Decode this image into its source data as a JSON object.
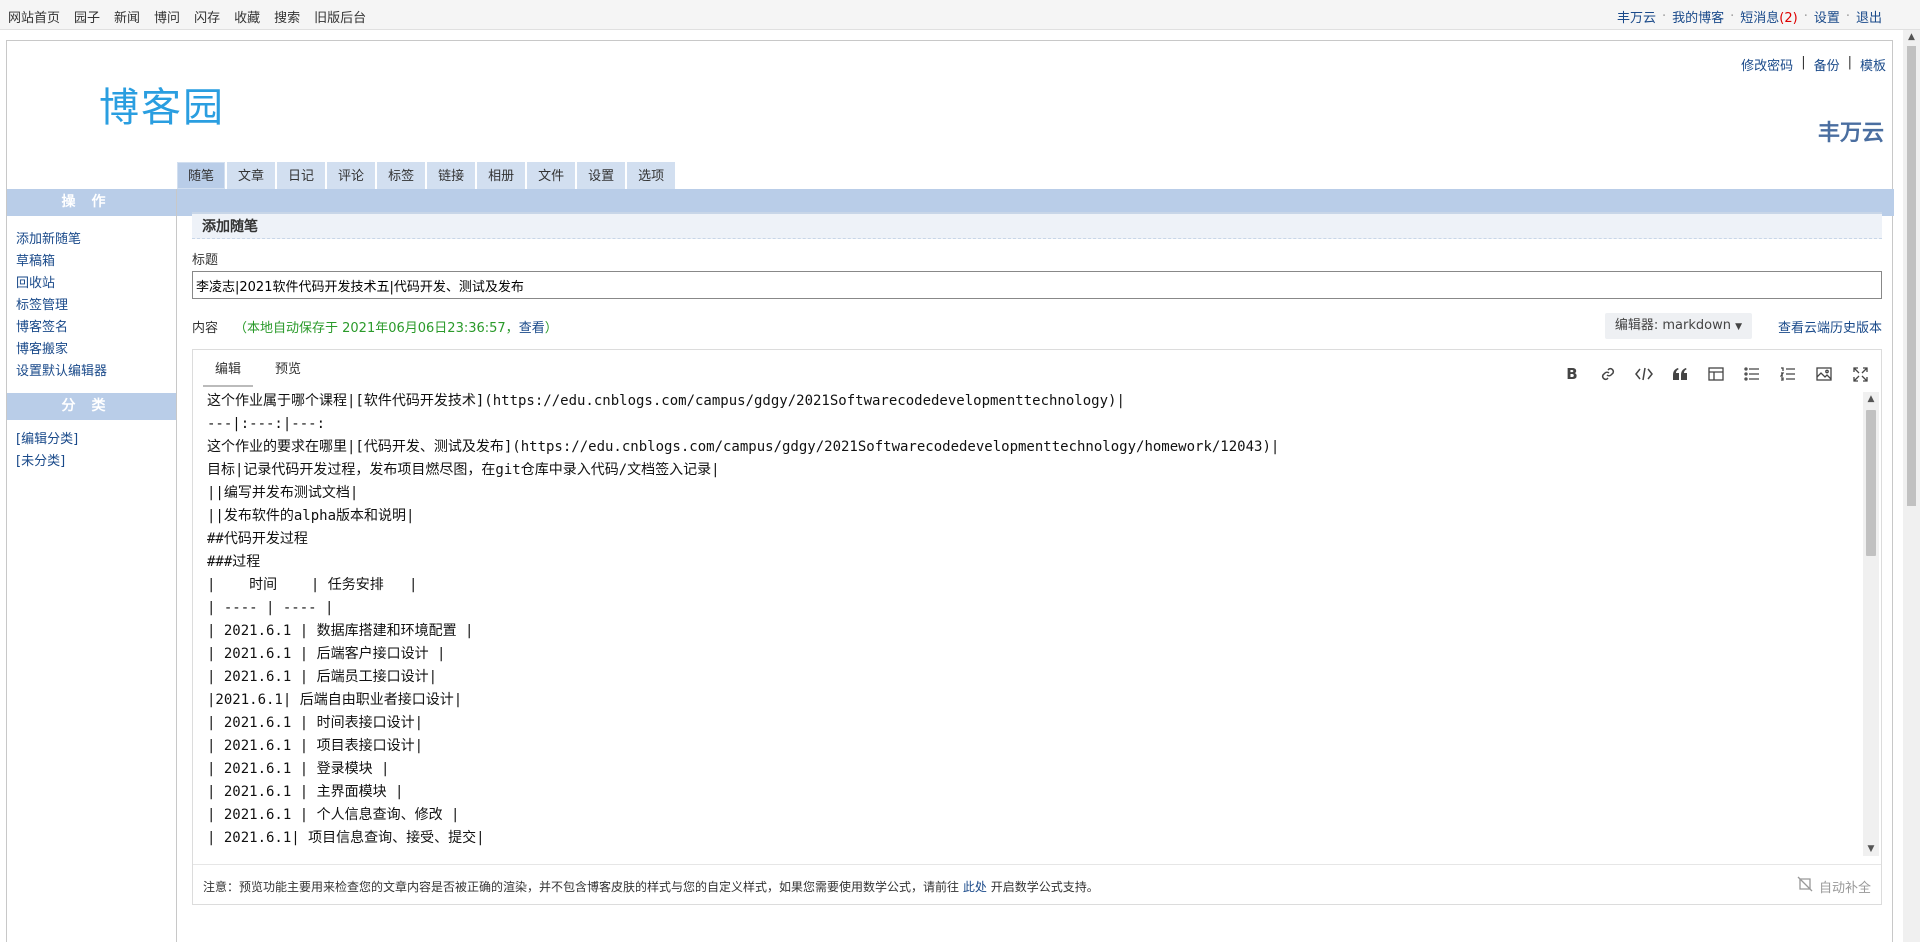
{
  "topbar": {
    "left_links": [
      "网站首页",
      "园子",
      "新闻",
      "博问",
      "闪存",
      "收藏",
      "搜索",
      "旧版后台"
    ],
    "user_name": "丰万云",
    "my_blog": "我的博客",
    "messages_label": "短消息",
    "messages_count": "(2)",
    "settings": "设置",
    "logout": "退出",
    "separator": "·"
  },
  "header": {
    "logo_text": "博客园",
    "change_password": "修改密码",
    "backup": "备份",
    "template": "模板",
    "pipe": "|",
    "blog_owner": "丰万云"
  },
  "tabs": [
    "随笔",
    "文章",
    "日记",
    "评论",
    "标签",
    "链接",
    "相册",
    "文件",
    "设置",
    "选项"
  ],
  "sidebar": {
    "ops_title": "操作",
    "ops": [
      "添加新随笔",
      "草稿箱",
      "回收站",
      "标签管理",
      "博客签名",
      "博客搬家",
      "设置默认编辑器"
    ],
    "cats_title": "分类",
    "cats": [
      "[编辑分类]",
      "[未分类]"
    ]
  },
  "form": {
    "section_title": "添加随笔",
    "title_label": "标题",
    "title_value": "李凌志|2021软件代码开发技术五|代码开发、测试及发布",
    "content_label": "内容",
    "autosave_text": "（本地自动保存于 2021年06月06日23:36:57，",
    "autosave_view": "查看",
    "autosave_close": "）",
    "editor_select": "编辑器: markdown",
    "cloud_history": "查看云端历史版本"
  },
  "editor": {
    "tab_edit": "编辑",
    "tab_preview": "预览",
    "tools": {
      "bold": "B",
      "link": "🔗",
      "code": "</>",
      "quote": "❝",
      "table": "⊞",
      "ul": "☰",
      "ol": "☷",
      "image": "▣",
      "fullscreen": "⤢"
    },
    "lines": [
      "这个作业属于哪个课程|[软件代码开发技术](https://edu.cnblogs.com/campus/gdgy/2021Softwarecodedevelopmenttechnology)|",
      "---|:---:|---:",
      "这个作业的要求在哪里|[代码开发、测试及发布](https://edu.cnblogs.com/campus/gdgy/2021Softwarecodedevelopmenttechnology/homework/12043)|",
      "目标|记录代码开发过程，发布项目燃尽图，在git仓库中录入代码/文档签入记录|",
      "||编写并发布测试文档|",
      "||发布软件的alpha版本和说明|",
      "##代码开发过程",
      "###过程",
      "|    时间    | 任务安排   |",
      "| ---- | ---- |",
      "| 2021.6.1 | 数据库搭建和环境配置 |",
      "| 2021.6.1 | 后端客户接口设计 |",
      "| 2021.6.1 | 后端员工接口设计|",
      "|2021.6.1| 后端自由职业者接口设计|",
      "| 2021.6.1 | 时间表接口设计|",
      "| 2021.6.1 | 项目表接口设计|",
      "| 2021.6.1 | 登录模块 |",
      "| 2021.6.1 | 主界面模块 |",
      "| 2021.6.1 | 个人信息查询、修改 |",
      "| 2021.6.1| 项目信息查询、接受、提交|"
    ],
    "notice_text": "注意：预览功能主要用来检查您的文章内容是否被正确的渲染，并不包含博客皮肤的样式与您的自定义样式，如果您需要使用数学公式，请前往",
    "notice_link": "此处",
    "notice_tail": "开启数学公式支持。",
    "autocomplete": "自动补全"
  },
  "colors": {
    "accent": "#b9cde8",
    "link": "#1a4a8a",
    "autosave": "#2a9a2a",
    "logo": "#2a9ee0"
  }
}
